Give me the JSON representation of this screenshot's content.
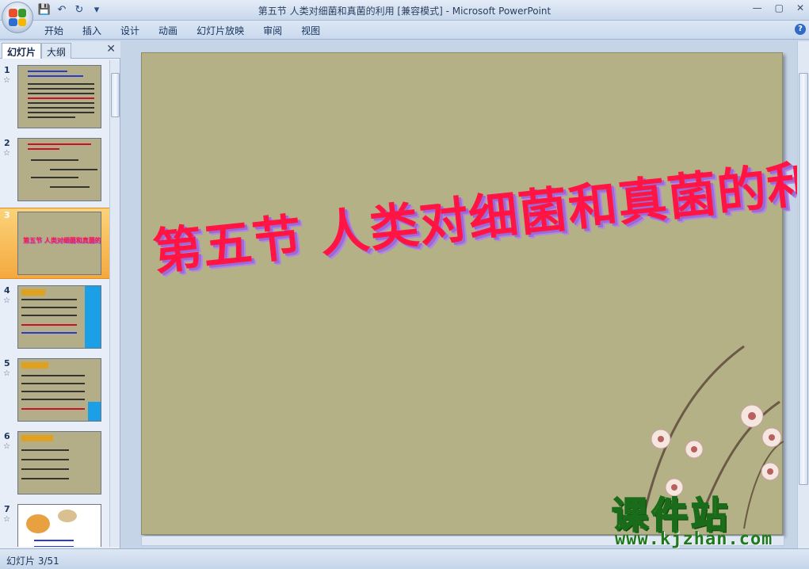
{
  "window": {
    "title_doc": "第五节 人类对细菌和真菌的利用 [兼容模式]",
    "title_sep": " - ",
    "title_app": "Microsoft PowerPoint",
    "minimize": "—",
    "maximize": "▢",
    "close": "✕"
  },
  "menu": [
    "开始",
    "插入",
    "设计",
    "动画",
    "幻灯片放映",
    "审阅",
    "视图"
  ],
  "help_label": "?",
  "pane": {
    "tab_slides": "幻灯片",
    "tab_outline": "大纲",
    "close": "✕",
    "thumbs": [
      {
        "num": "1",
        "star": "☆"
      },
      {
        "num": "2",
        "star": "☆"
      },
      {
        "num": "3",
        "star": ""
      },
      {
        "num": "4",
        "star": "☆"
      },
      {
        "num": "5",
        "star": "☆"
      },
      {
        "num": "6",
        "star": "☆"
      },
      {
        "num": "7",
        "star": "☆"
      }
    ],
    "thumb3_title": "第五节 人类对细菌和真菌的利用"
  },
  "slide": {
    "title": "第五节 人类对细菌和真菌的利用"
  },
  "status": {
    "text": "幻灯片 3/51"
  },
  "watermark": {
    "text": "课件站",
    "url": "www.kjzhan.com"
  },
  "colors": {
    "slide_bg": "#b5b187",
    "title_color": "#ff1443",
    "selected_thumb": "#f5a93f"
  }
}
